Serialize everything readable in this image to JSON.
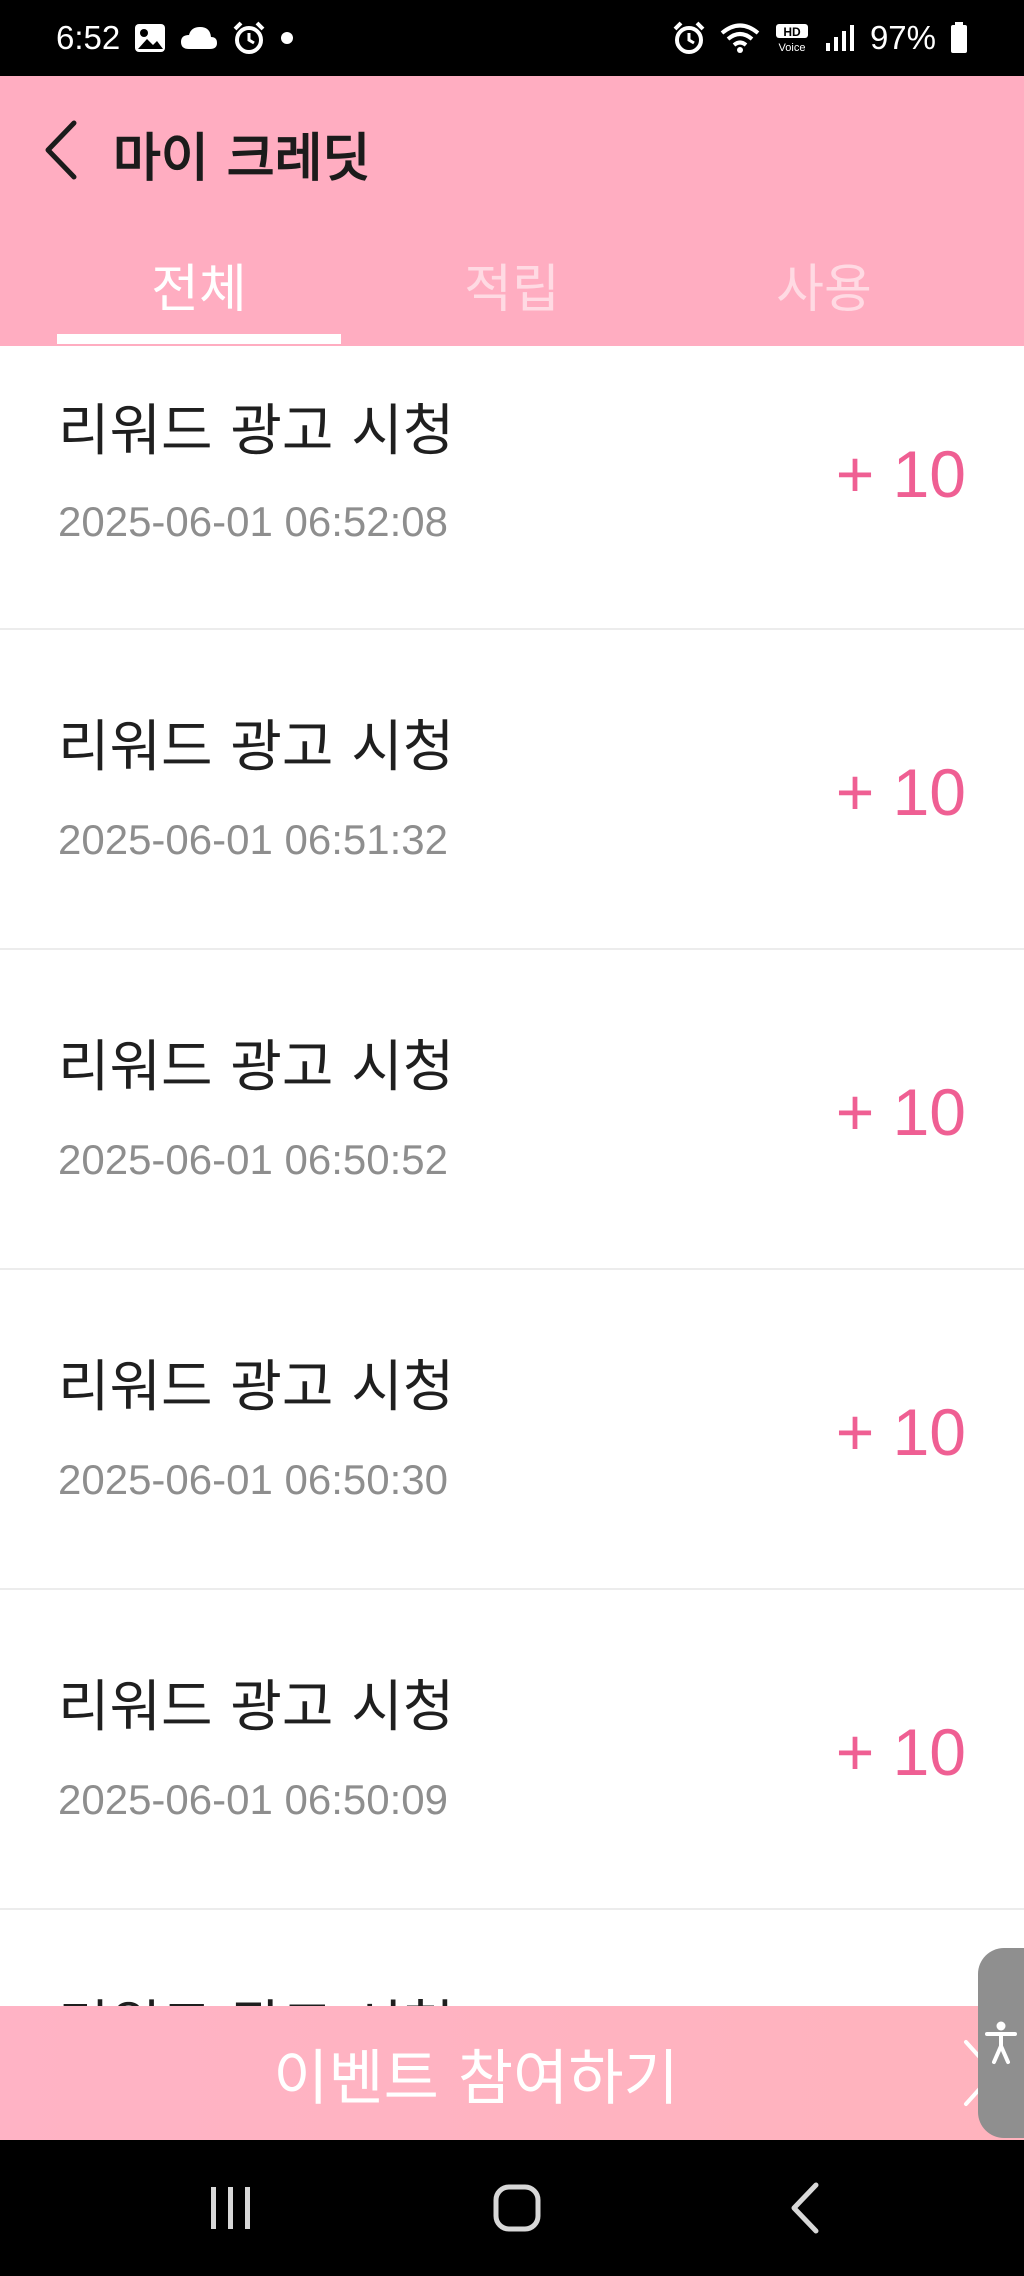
{
  "status_bar": {
    "time": "6:52",
    "battery": "97%",
    "left_icons": [
      "image-icon",
      "cloud-icon",
      "alarm-icon",
      "dot-icon"
    ],
    "right_icons": [
      "alarm-icon",
      "wifi-icon",
      "hd-voice-icon",
      "signal-icon",
      "battery-icon"
    ]
  },
  "header": {
    "title": "마이 크레딧",
    "background": "#ffadc1",
    "tabs": [
      {
        "label": "전체",
        "active": true
      },
      {
        "label": "적립",
        "active": false
      },
      {
        "label": "사용",
        "active": false
      }
    ]
  },
  "credit_list": [
    {
      "title": "리워드 광고 시청",
      "date": "2025-06-01 06:52:08",
      "amount": "+ 10"
    },
    {
      "title": "리워드 광고 시청",
      "date": "2025-06-01 06:51:32",
      "amount": "+ 10"
    },
    {
      "title": "리워드 광고 시청",
      "date": "2025-06-01 06:50:52",
      "amount": "+ 10"
    },
    {
      "title": "리워드 광고 시청",
      "date": "2025-06-01 06:50:30",
      "amount": "+ 10"
    },
    {
      "title": "리워드 광고 시청",
      "date": "2025-06-01 06:50:09",
      "amount": "+ 10"
    },
    {
      "title": "리워드 광고 시청",
      "date": "",
      "amount": ""
    }
  ],
  "event_banner": {
    "label": "이벤트 참여하기"
  },
  "colors": {
    "accent": "#ef5f93",
    "header": "#ffadc1",
    "banner": "#ffb3c5"
  }
}
